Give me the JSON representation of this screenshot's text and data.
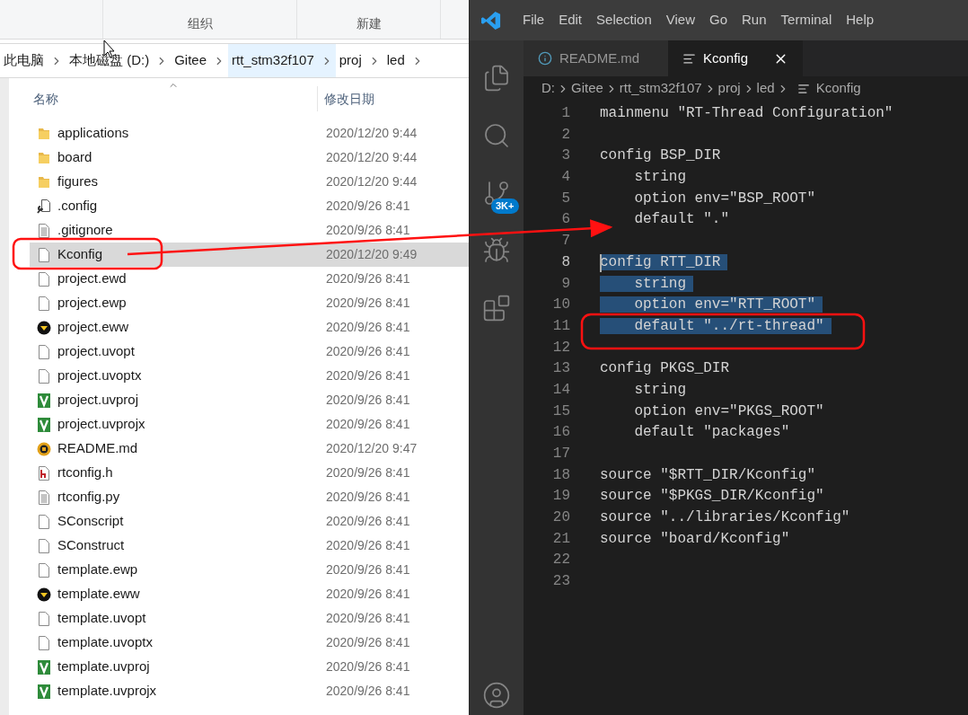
{
  "explorer": {
    "ribbon_groups": [
      "组织",
      "新建"
    ],
    "address_path": [
      {
        "label": "此电脑",
        "selected": false
      },
      {
        "label": "本地磁盘 (D:)",
        "selected": false
      },
      {
        "label": "Gitee",
        "selected": false
      },
      {
        "label": "rtt_stm32f107",
        "selected": true
      },
      {
        "label": "proj",
        "selected": false
      },
      {
        "label": "led",
        "selected": false
      }
    ],
    "columns": [
      "名称",
      "修改日期"
    ],
    "files": [
      {
        "name": "applications",
        "date": "2020/12/20 9:44",
        "kind": "folder",
        "selected": false
      },
      {
        "name": "board",
        "date": "2020/12/20 9:44",
        "kind": "folder",
        "selected": false
      },
      {
        "name": "figures",
        "date": "2020/12/20 9:44",
        "kind": "folder",
        "selected": false
      },
      {
        "name": ".config",
        "date": "2020/9/26 8:41",
        "kind": "config",
        "selected": false
      },
      {
        "name": ".gitignore",
        "date": "2020/9/26 8:41",
        "kind": "text",
        "selected": false
      },
      {
        "name": "Kconfig",
        "date": "2020/12/20 9:49",
        "kind": "blank",
        "selected": true
      },
      {
        "name": "project.ewd",
        "date": "2020/9/26 8:41",
        "kind": "blank",
        "selected": false
      },
      {
        "name": "project.ewp",
        "date": "2020/9/26 8:41",
        "kind": "blank",
        "selected": false
      },
      {
        "name": "project.eww",
        "date": "2020/9/26 8:41",
        "kind": "workspace",
        "selected": false
      },
      {
        "name": "project.uvopt",
        "date": "2020/9/26 8:41",
        "kind": "blank",
        "selected": false
      },
      {
        "name": "project.uvoptx",
        "date": "2020/9/26 8:41",
        "kind": "blank",
        "selected": false
      },
      {
        "name": "project.uvproj",
        "date": "2020/9/26 8:41",
        "kind": "keil",
        "selected": false
      },
      {
        "name": "project.uvprojx",
        "date": "2020/9/26 8:41",
        "kind": "keil",
        "selected": false
      },
      {
        "name": "README.md",
        "date": "2020/12/20 9:47",
        "kind": "editor",
        "selected": false
      },
      {
        "name": "rtconfig.h",
        "date": "2020/9/26 8:41",
        "kind": "header",
        "selected": false
      },
      {
        "name": "rtconfig.py",
        "date": "2020/9/26 8:41",
        "kind": "text",
        "selected": false
      },
      {
        "name": "SConscript",
        "date": "2020/9/26 8:41",
        "kind": "blank",
        "selected": false
      },
      {
        "name": "SConstruct",
        "date": "2020/9/26 8:41",
        "kind": "blank",
        "selected": false
      },
      {
        "name": "template.ewp",
        "date": "2020/9/26 8:41",
        "kind": "blank",
        "selected": false
      },
      {
        "name": "template.eww",
        "date": "2020/9/26 8:41",
        "kind": "workspace",
        "selected": false
      },
      {
        "name": "template.uvopt",
        "date": "2020/9/26 8:41",
        "kind": "blank",
        "selected": false
      },
      {
        "name": "template.uvoptx",
        "date": "2020/9/26 8:41",
        "kind": "blank",
        "selected": false
      },
      {
        "name": "template.uvproj",
        "date": "2020/9/26 8:41",
        "kind": "keil",
        "selected": false
      },
      {
        "name": "template.uvprojx",
        "date": "2020/9/26 8:41",
        "kind": "keil",
        "selected": false
      }
    ]
  },
  "editor": {
    "menu": [
      "File",
      "Edit",
      "Selection",
      "View",
      "Go",
      "Run",
      "Terminal",
      "Help"
    ],
    "tabs": [
      {
        "label": "README.md",
        "kind": "info",
        "selected": false
      },
      {
        "label": "Kconfig",
        "kind": "text",
        "selected": true
      }
    ],
    "breadcrumb": [
      {
        "label": "D:",
        "kind": "folder"
      },
      {
        "label": "Gitee",
        "kind": "folder"
      },
      {
        "label": "rtt_stm32f107",
        "kind": "folder"
      },
      {
        "label": "proj",
        "kind": "folder"
      },
      {
        "label": "led",
        "kind": "folder"
      },
      {
        "label": "Kconfig",
        "kind": "file"
      }
    ],
    "activity": [
      {
        "kind": "files",
        "selected": false
      },
      {
        "kind": "search",
        "selected": false
      },
      {
        "kind": "source",
        "selected": false,
        "badge": "3K+"
      },
      {
        "kind": "debug",
        "selected": false
      },
      {
        "kind": "extensions",
        "selected": false
      }
    ],
    "account": {
      "kind": "account"
    },
    "lines": [
      {
        "number": "1",
        "text": "mainmenu \"RT-Thread Configuration\"",
        "selected": false,
        "cursor": false
      },
      {
        "number": "2",
        "selected": false,
        "cursor": false
      },
      {
        "number": "3",
        "text": "config BSP_DIR",
        "selected": false,
        "cursor": false
      },
      {
        "number": "4",
        "text": "    string",
        "selected": false,
        "cursor": false
      },
      {
        "number": "5",
        "text": "    option env=\"BSP_ROOT\"",
        "selected": false,
        "cursor": false
      },
      {
        "number": "6",
        "text": "    default \".\"",
        "selected": false,
        "cursor": false
      },
      {
        "number": "7",
        "selected": false,
        "cursor": false
      },
      {
        "number": "8",
        "text": "config RTT_DIR",
        "selected": true,
        "cursor": true
      },
      {
        "number": "9",
        "text": "    string",
        "selected": true,
        "cursor": false
      },
      {
        "number": "10",
        "text": "    option env=\"RTT_ROOT\"",
        "selected": true,
        "cursor": false
      },
      {
        "number": "11",
        "text": "    default \"../rt-thread\"",
        "selected": true,
        "cursor": false
      },
      {
        "number": "12",
        "selected": false,
        "cursor": false
      },
      {
        "number": "13",
        "text": "config PKGS_DIR",
        "selected": false,
        "cursor": false
      },
      {
        "number": "14",
        "text": "    string",
        "selected": false,
        "cursor": false
      },
      {
        "number": "15",
        "text": "    option env=\"PKGS_ROOT\"",
        "selected": false,
        "cursor": false
      },
      {
        "number": "16",
        "text": "    default \"packages\"",
        "selected": false,
        "cursor": false
      },
      {
        "number": "17",
        "selected": false,
        "cursor": false
      },
      {
        "number": "18",
        "text": "source \"$RTT_DIR/Kconfig\"",
        "selected": false,
        "cursor": false
      },
      {
        "number": "19",
        "text": "source \"$PKGS_DIR/Kconfig\"",
        "selected": false,
        "cursor": false
      },
      {
        "number": "20",
        "text": "source \"../libraries/Kconfig\"",
        "selected": false,
        "cursor": false
      },
      {
        "number": "21",
        "text": "source \"board/Kconfig\"",
        "selected": false,
        "cursor": false
      },
      {
        "number": "22",
        "selected": false,
        "cursor": false
      },
      {
        "number": "23",
        "selected": false,
        "cursor": false
      }
    ]
  }
}
